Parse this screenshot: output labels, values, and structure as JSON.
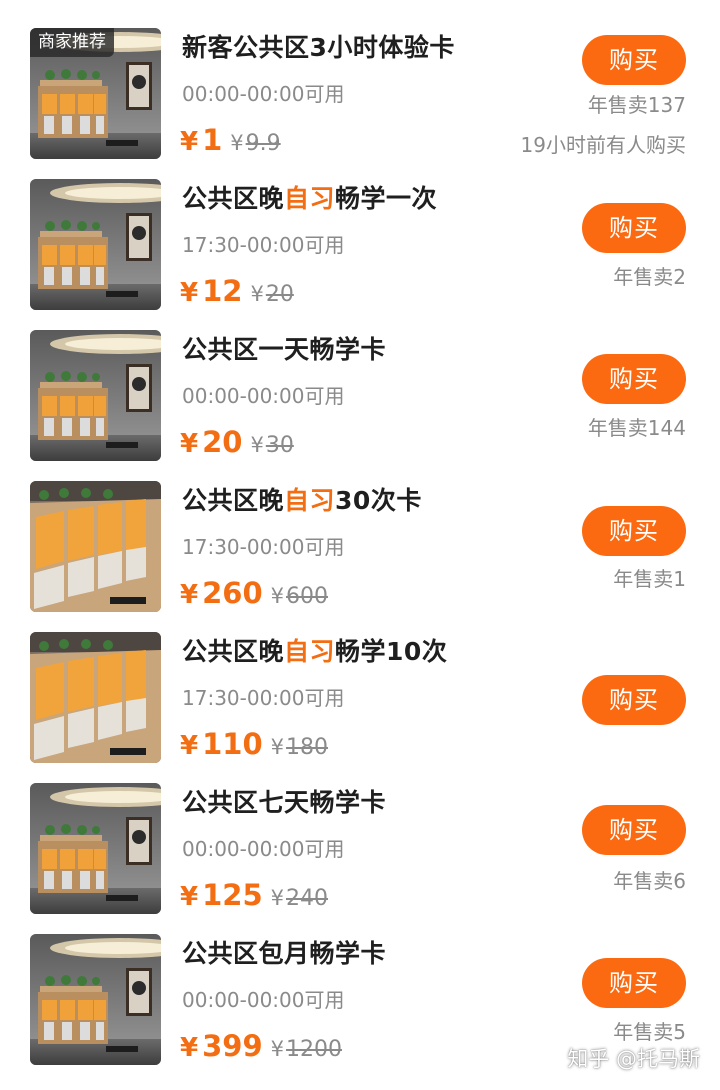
{
  "currency_symbol": "¥",
  "colors": {
    "accent": "#f36d12",
    "buy_button": "#fb6a10",
    "muted": "#8a8a8a"
  },
  "products": [
    {
      "badge": "商家推荐",
      "title_parts": [
        "新客公共区3小时体验卡",
        "",
        ""
      ],
      "hours": "00:00-00:00可用",
      "price": "1",
      "original_price": "9.9",
      "buy_label": "购买",
      "sales": "年售卖137",
      "recent": "19小时前有人购买",
      "image_variant": "lounge"
    },
    {
      "badge": "",
      "title_parts": [
        "公共区晚",
        "自习",
        "畅学一次"
      ],
      "hours": "17:30-00:00可用",
      "price": "12",
      "original_price": "20",
      "buy_label": "购买",
      "sales": "年售卖2",
      "recent": "",
      "image_variant": "lounge"
    },
    {
      "badge": "",
      "title_parts": [
        "公共区一天畅学卡",
        "",
        ""
      ],
      "hours": "00:00-00:00可用",
      "price": "20",
      "original_price": "30",
      "buy_label": "购买",
      "sales": "年售卖144",
      "recent": "",
      "image_variant": "lounge"
    },
    {
      "badge": "",
      "title_parts": [
        "公共区晚",
        "自习",
        "30次卡"
      ],
      "hours": "17:30-00:00可用",
      "price": "260",
      "original_price": "600",
      "buy_label": "购买",
      "sales": "年售卖1",
      "recent": "",
      "image_variant": "booths"
    },
    {
      "badge": "",
      "title_parts": [
        "公共区晚",
        "自习",
        "畅学10次"
      ],
      "hours": "17:30-00:00可用",
      "price": "110",
      "original_price": "180",
      "buy_label": "购买",
      "sales": "",
      "recent": "",
      "image_variant": "booths"
    },
    {
      "badge": "",
      "title_parts": [
        "公共区七天畅学卡",
        "",
        ""
      ],
      "hours": "00:00-00:00可用",
      "price": "125",
      "original_price": "240",
      "buy_label": "购买",
      "sales": "年售卖6",
      "recent": "",
      "image_variant": "lounge"
    },
    {
      "badge": "",
      "title_parts": [
        "公共区包月畅学卡",
        "",
        ""
      ],
      "hours": "00:00-00:00可用",
      "price": "399",
      "original_price": "1200",
      "buy_label": "购买",
      "sales": "年售卖5",
      "recent": "",
      "image_variant": "lounge"
    }
  ],
  "watermark": "知乎 @托马斯"
}
